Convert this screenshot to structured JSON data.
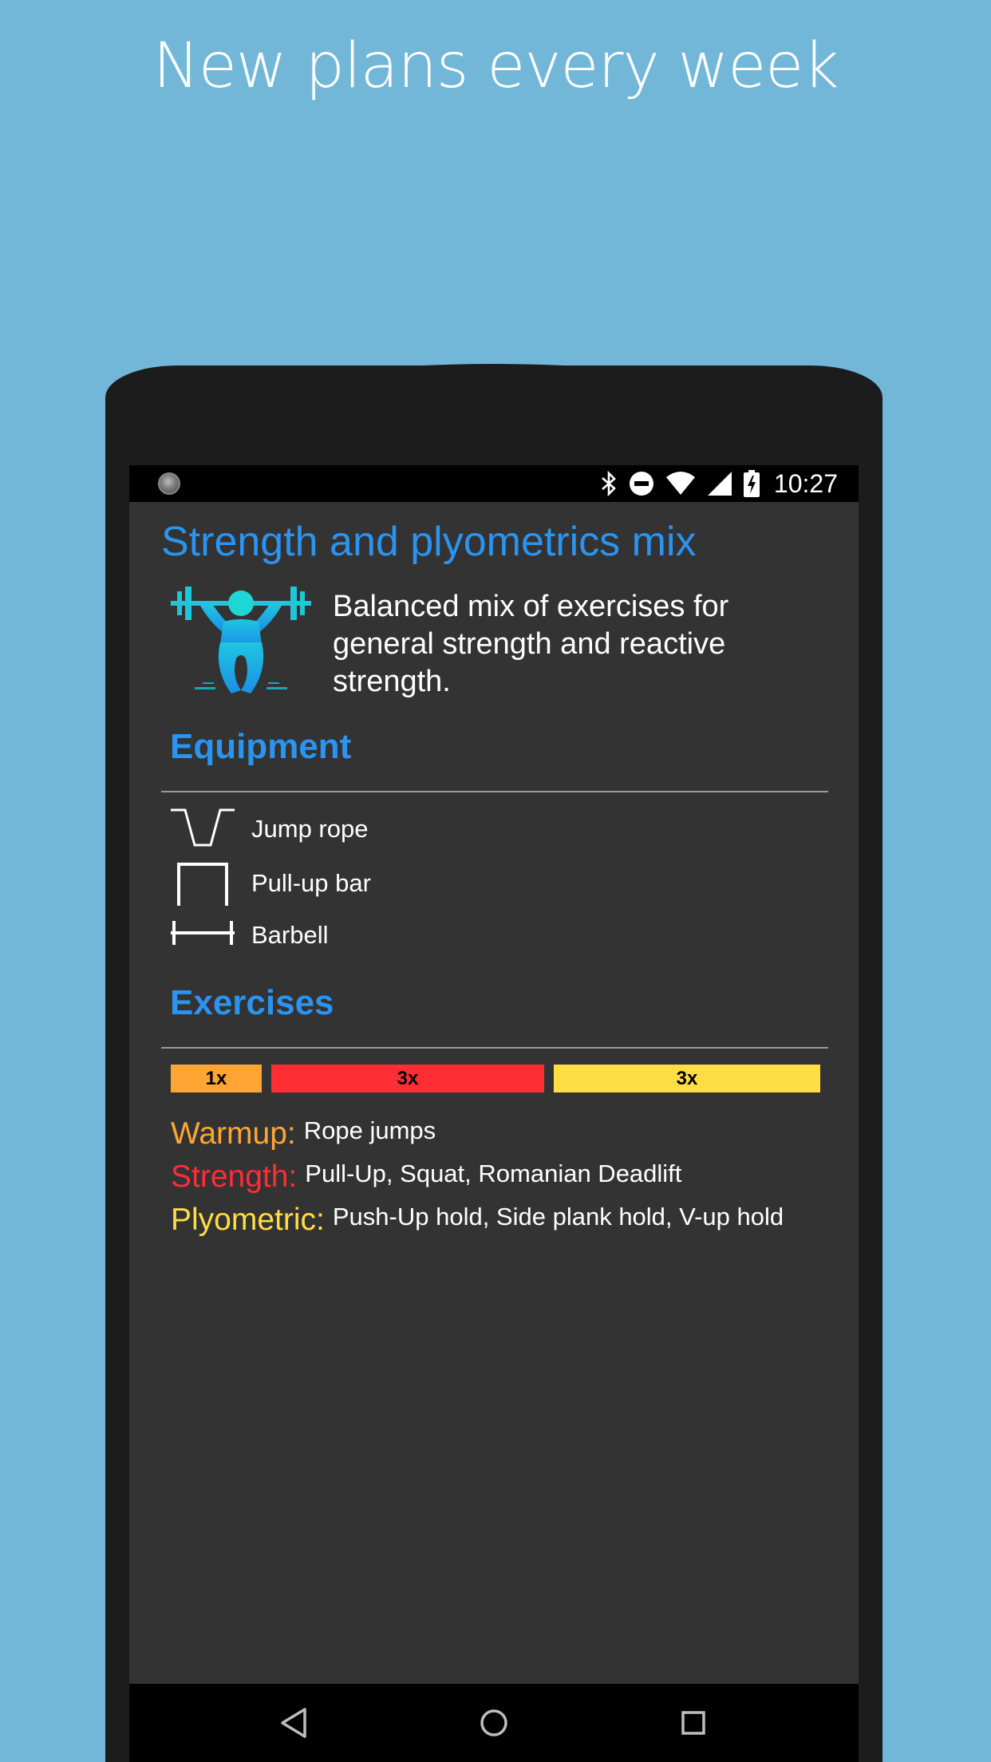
{
  "headline": "New plans every week",
  "status_bar": {
    "time": "10:27",
    "icons": [
      "notification-circle-icon",
      "bluetooth-icon",
      "do-not-disturb-icon",
      "wifi-icon",
      "cell-signal-icon",
      "battery-charging-icon"
    ]
  },
  "plan": {
    "title": "Strength and plyometrics mix",
    "icon": "weightlifter-icon",
    "description": "Balanced mix of exercises for general strength and reactive strength."
  },
  "equipment": {
    "title": "Equipment",
    "items": [
      {
        "label": "Jump rope",
        "icon": "jump-rope-icon"
      },
      {
        "label": "Pull-up bar",
        "icon": "pull-up-bar-icon"
      },
      {
        "label": "Barbell",
        "icon": "barbell-icon"
      }
    ]
  },
  "exercises": {
    "title": "Exercises",
    "bars": [
      {
        "label": "1x",
        "color": "#ffa533"
      },
      {
        "label": "3x",
        "color": "#ff2d34"
      },
      {
        "label": "3x",
        "color": "#ffdd44"
      }
    ],
    "groups": [
      {
        "label": "Warmup:",
        "value": "Rope jumps",
        "color": "#ffa533"
      },
      {
        "label": "Strength:",
        "value": "Pull-Up, Squat, Romanian Deadlift",
        "color": "#ff2d34"
      },
      {
        "label": "Plyometric:",
        "value": "Push-Up hold, Side plank hold, V-up hold",
        "color": "#ffdd44"
      }
    ]
  },
  "nav_bar": {
    "icons": [
      "back-icon",
      "home-icon",
      "recents-icon"
    ]
  },
  "colors": {
    "accent": "#2b93f0",
    "background": "#72b7d8",
    "screen": "#333333"
  }
}
